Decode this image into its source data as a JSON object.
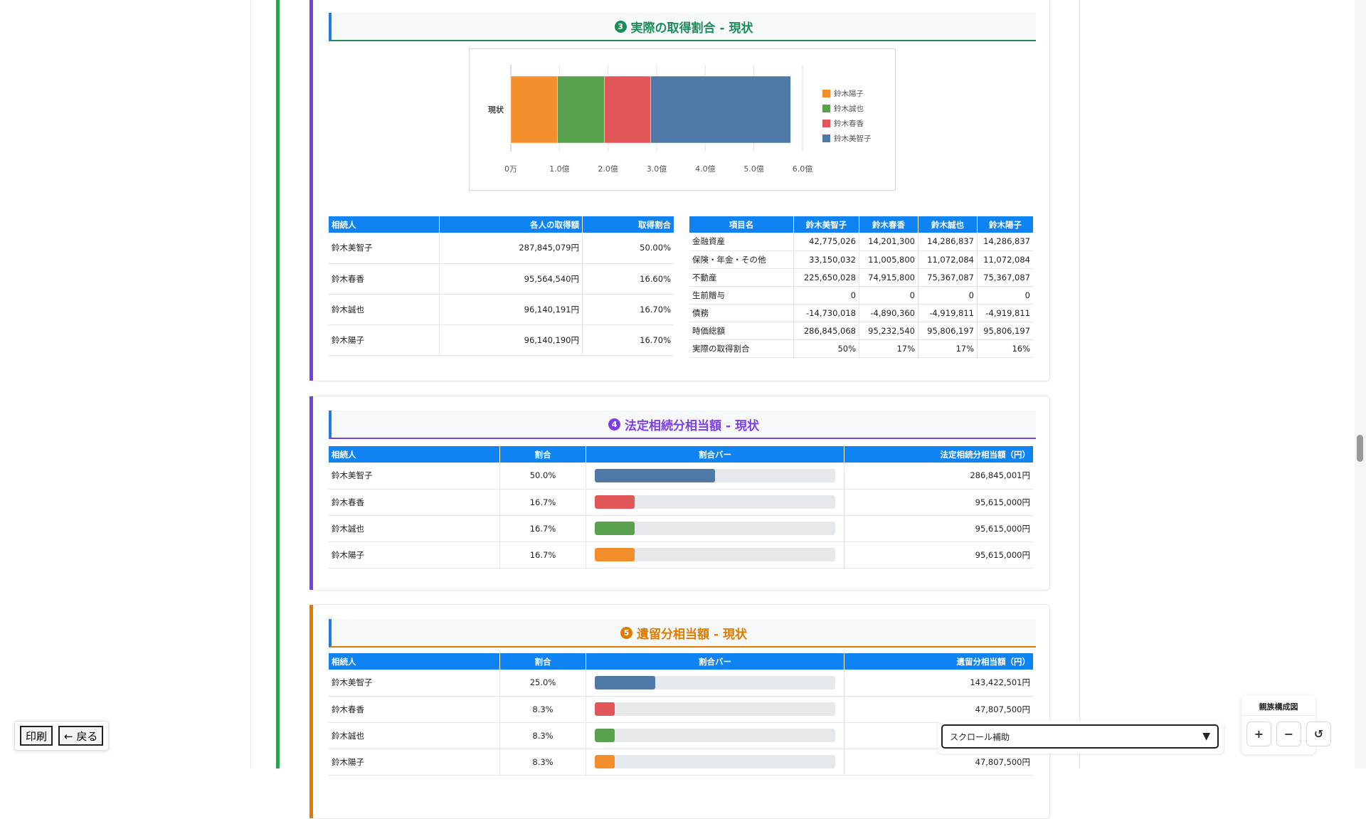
{
  "section3": {
    "num": "3",
    "title": "実際の取得割合 - 現状",
    "accent": "#1e8c5a",
    "chart_data": {
      "type": "bar",
      "orientation": "horizontal",
      "stacked": true,
      "categories": [
        "現状"
      ],
      "series": [
        {
          "name": "鈴木陽子",
          "values": [
            96140190
          ],
          "color": "#f28e2b"
        },
        {
          "name": "鈴木誠也",
          "values": [
            96140191
          ],
          "color": "#59a14f"
        },
        {
          "name": "鈴木春香",
          "values": [
            95564540
          ],
          "color": "#e15759"
        },
        {
          "name": "鈴木美智子",
          "values": [
            287845079
          ],
          "color": "#4e79a7"
        }
      ],
      "x_ticks": [
        "0万",
        "1.0億",
        "2.0億",
        "3.0億",
        "4.0億",
        "5.0億",
        "6.0億"
      ],
      "xlim": [
        0,
        600000000
      ],
      "legend": "right"
    },
    "table1": {
      "headers": [
        "相続人",
        "各人の取得額",
        "取得割合"
      ],
      "rows": [
        [
          "鈴木美智子",
          "287,845,079円",
          "50.00%"
        ],
        [
          "鈴木春香",
          "95,564,540円",
          "16.60%"
        ],
        [
          "鈴木誠也",
          "96,140,191円",
          "16.70%"
        ],
        [
          "鈴木陽子",
          "96,140,190円",
          "16.70%"
        ]
      ]
    },
    "table2": {
      "headers": [
        "項目名",
        "鈴木美智子",
        "鈴木春香",
        "鈴木誠也",
        "鈴木陽子"
      ],
      "rows": [
        [
          "金融資産",
          "42,775,026",
          "14,201,300",
          "14,286,837",
          "14,286,837"
        ],
        [
          "保険・年金・その他",
          "33,150,032",
          "11,005,800",
          "11,072,084",
          "11,072,084"
        ],
        [
          "不動産",
          "225,650,028",
          "74,915,800",
          "75,367,087",
          "75,367,087"
        ],
        [
          "生前贈与",
          "0",
          "0",
          "0",
          "0"
        ],
        [
          "債務",
          "-14,730,018",
          "-4,890,360",
          "-4,919,811",
          "-4,919,811"
        ],
        [
          "時価総額",
          "286,845,068",
          "95,232,540",
          "95,806,197",
          "95,806,197"
        ],
        [
          "実際の取得割合",
          "50%",
          "17%",
          "17%",
          "16%"
        ]
      ]
    }
  },
  "section4": {
    "num": "4",
    "title": "法定相続分相当額 - 現状",
    "accent": "#7b3fe4",
    "headers": [
      "相続人",
      "割合",
      "割合バー",
      "法定相続分相当額（円）"
    ],
    "rows": [
      {
        "name": "鈴木美智子",
        "pct": "50.0%",
        "ratio": 0.5,
        "color": "#4e79a7",
        "amount": "286,845,001円"
      },
      {
        "name": "鈴木春香",
        "pct": "16.7%",
        "ratio": 0.167,
        "color": "#e15759",
        "amount": "95,615,000円"
      },
      {
        "name": "鈴木誠也",
        "pct": "16.7%",
        "ratio": 0.167,
        "color": "#59a14f",
        "amount": "95,615,000円"
      },
      {
        "name": "鈴木陽子",
        "pct": "16.7%",
        "ratio": 0.167,
        "color": "#f28e2b",
        "amount": "95,615,000円"
      }
    ]
  },
  "section5": {
    "num": "5",
    "title": "遺留分相当額 - 現状",
    "accent": "#e07b00",
    "headers": [
      "相続人",
      "割合",
      "割合バー",
      "遺留分相当額（円）"
    ],
    "rows": [
      {
        "name": "鈴木美智子",
        "pct": "25.0%",
        "ratio": 0.25,
        "color": "#4e79a7",
        "amount": "143,422,501円"
      },
      {
        "name": "鈴木春香",
        "pct": "8.3%",
        "ratio": 0.083,
        "color": "#e15759",
        "amount": "47,807,500円"
      },
      {
        "name": "鈴木誠也",
        "pct": "8.3%",
        "ratio": 0.083,
        "color": "#59a14f",
        "amount": ""
      },
      {
        "name": "鈴木陽子",
        "pct": "8.3%",
        "ratio": 0.083,
        "color": "#f28e2b",
        "amount": "47,807,500円"
      }
    ]
  },
  "controls": {
    "print": "印刷",
    "back": "← 戻る",
    "scroll_assist": "スクロール補助",
    "scroll_arrow": "▼",
    "family_title": "親族構成図",
    "zoom_in": "+",
    "zoom_out": "−",
    "reset": "↺"
  }
}
